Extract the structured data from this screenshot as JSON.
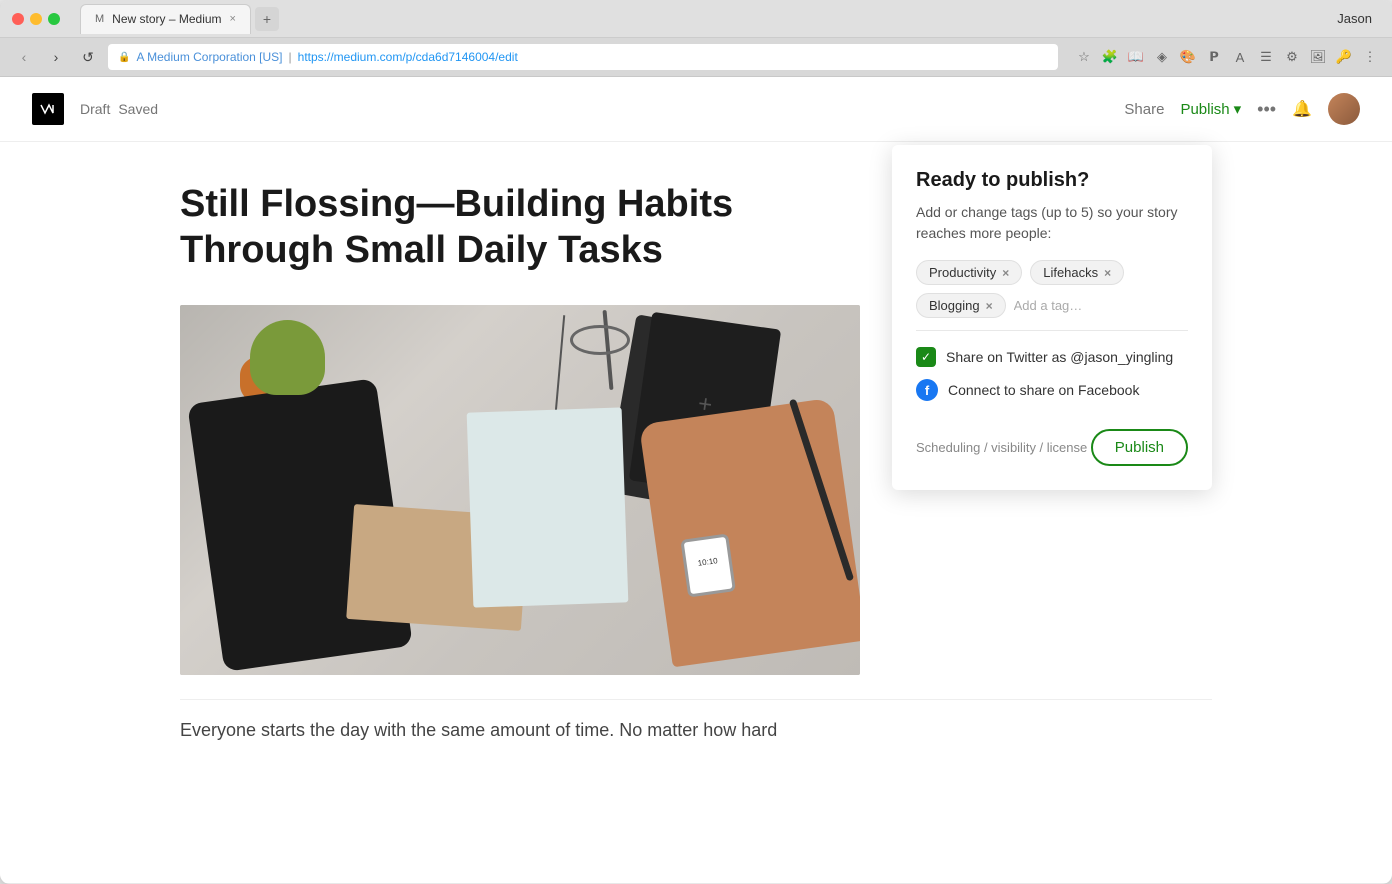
{
  "browser": {
    "traffic_lights": [
      "red",
      "yellow",
      "green"
    ],
    "tab_title": "New story – Medium",
    "tab_close": "×",
    "profile_name": "Jason",
    "address_site": "A Medium Corporation [US]",
    "address_url": "https://medium.com/p/cda6d7146004/edit",
    "nav_back": "‹",
    "nav_forward": "›",
    "nav_refresh": "↺"
  },
  "header": {
    "draft_label": "Draft",
    "saved_label": "Saved",
    "share_label": "Share",
    "publish_label": "Publish",
    "more_icon": "•••"
  },
  "article": {
    "title": "Still Flossing—Building Habits Through Small Daily Tasks",
    "preview_text": "Everyone starts the day with the same amount of time. No matter how hard"
  },
  "publish_panel": {
    "title": "Ready to publish?",
    "description": "Add or change tags (up to 5) so your story reaches more people:",
    "tags": [
      {
        "label": "Productivity",
        "removable": true
      },
      {
        "label": "Lifehacks",
        "removable": true
      },
      {
        "label": "Blogging",
        "removable": true
      }
    ],
    "tag_input_placeholder": "Add a tag…",
    "twitter_checked": true,
    "twitter_label": "Share on Twitter as @jason_yingling",
    "facebook_label": "Connect to share on Facebook",
    "scheduling_label": "Scheduling / visibility / license",
    "publish_btn_label": "Publish"
  }
}
